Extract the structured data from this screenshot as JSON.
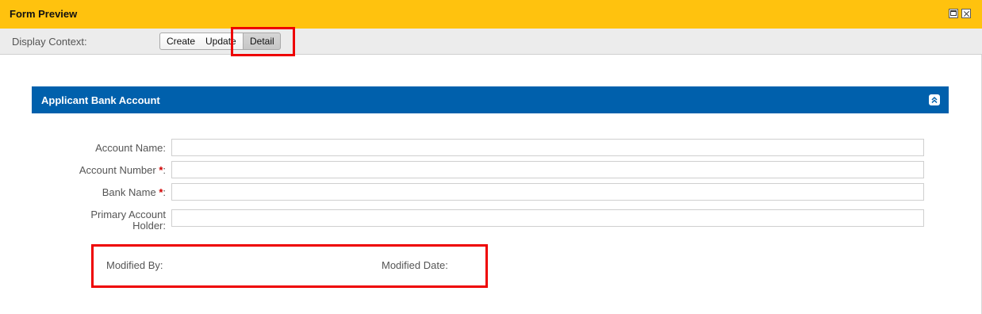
{
  "window": {
    "title": "Form Preview",
    "restore_button": "restore",
    "close_button": "close"
  },
  "context_bar": {
    "label": "Display Context:",
    "options": [
      {
        "label": "Create",
        "selected": false
      },
      {
        "label": "Update",
        "selected": false
      },
      {
        "label": "Detail",
        "selected": true
      }
    ]
  },
  "section": {
    "title": "Applicant Bank Account",
    "collapse_icon": "chevron-double-up-icon",
    "header_color": "#0060ac"
  },
  "fields": [
    {
      "label": "Account Name:",
      "required": false,
      "value": ""
    },
    {
      "label": "Account Number ",
      "required": true,
      "required_mark": "*",
      "suffix": ":",
      "value": ""
    },
    {
      "label": "Bank Name ",
      "required": true,
      "required_mark": "*",
      "suffix": ":",
      "value": ""
    },
    {
      "label_line1": "Primary Account",
      "label_line2": "Holder:",
      "required": false,
      "value": ""
    }
  ],
  "meta": {
    "modified_by_label": "Modified By:",
    "modified_date_label": "Modified Date:"
  },
  "colors": {
    "title_bar": "#ffc20e",
    "highlight": "#ee0000",
    "required": "#d00000"
  }
}
